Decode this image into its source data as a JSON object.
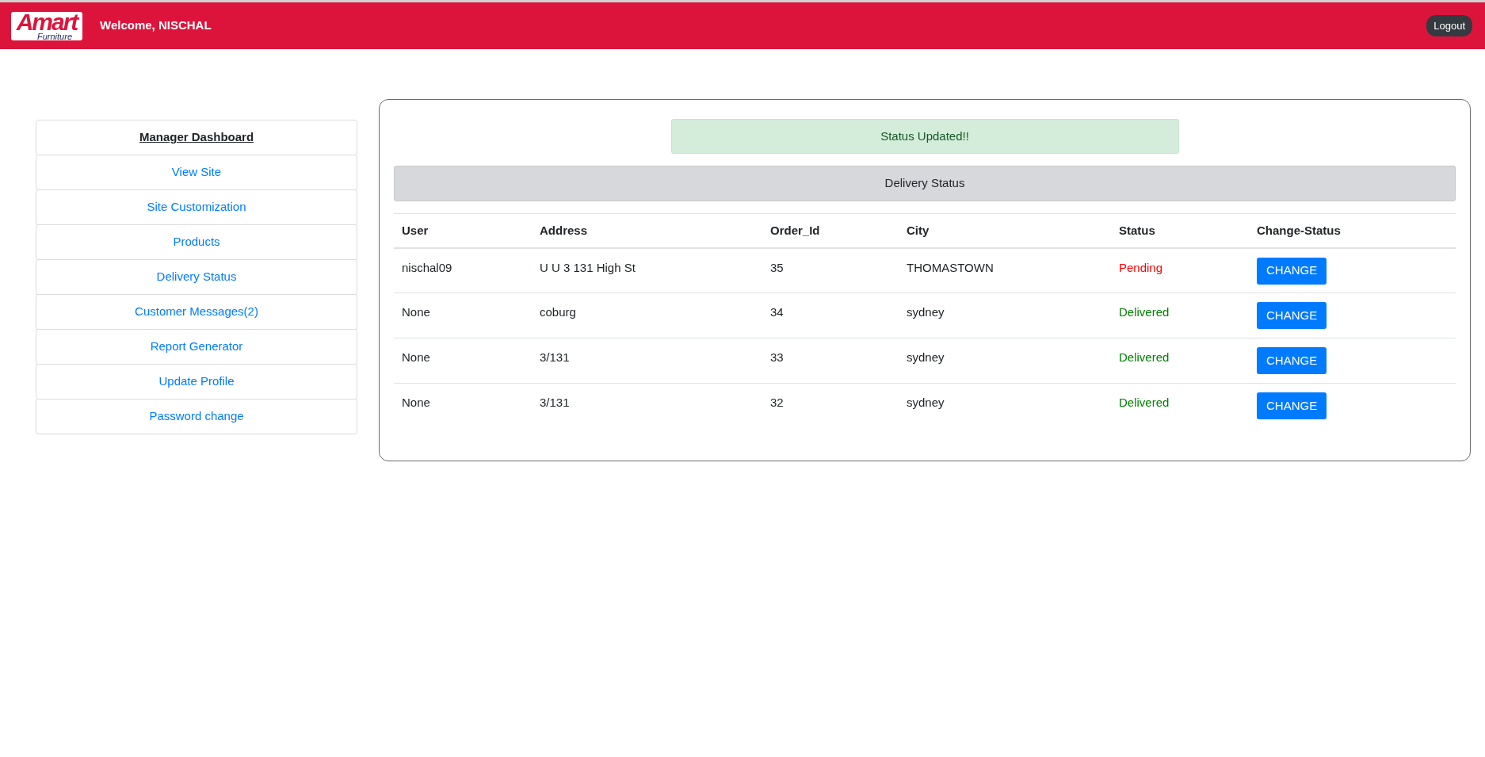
{
  "header": {
    "logo": {
      "word": "Amart",
      "subword": "Furniture"
    },
    "welcome": "Welcome, NISCHAL",
    "logout": "Logout"
  },
  "sidebar": {
    "items": [
      {
        "label": "Manager Dashboard",
        "kind": "heading"
      },
      {
        "label": "View Site",
        "kind": "link"
      },
      {
        "label": "Site Customization",
        "kind": "link"
      },
      {
        "label": "Products",
        "kind": "link"
      },
      {
        "label": "Delivery Status",
        "kind": "link"
      },
      {
        "label": "Customer Messages(2)",
        "kind": "link"
      },
      {
        "label": "Report Generator",
        "kind": "link"
      },
      {
        "label": "Update Profile",
        "kind": "link"
      },
      {
        "label": "Password change",
        "kind": "link"
      }
    ]
  },
  "alert": "Status Updated!!",
  "panel_title": "Delivery Status",
  "table": {
    "columns": [
      "User",
      "Address",
      "Order_Id",
      "City",
      "Status",
      "Change-Status"
    ],
    "rows": [
      {
        "user": "nischal09",
        "address": "U U 3 131 High St",
        "order_id": "35",
        "city": "THOMASTOWN",
        "status": "Pending",
        "color": "#ff0000",
        "action": "CHANGE"
      },
      {
        "user": "None",
        "address": "coburg",
        "order_id": "34",
        "city": "sydney",
        "status": "Delivered",
        "color": "#008000",
        "action": "CHANGE"
      },
      {
        "user": "None",
        "address": "3/131",
        "order_id": "33",
        "city": "sydney",
        "status": "Delivered",
        "color": "#008000",
        "action": "CHANGE"
      },
      {
        "user": "None",
        "address": "3/131",
        "order_id": "32",
        "city": "sydney",
        "status": "Delivered",
        "color": "#008000",
        "action": "CHANGE"
      }
    ]
  }
}
